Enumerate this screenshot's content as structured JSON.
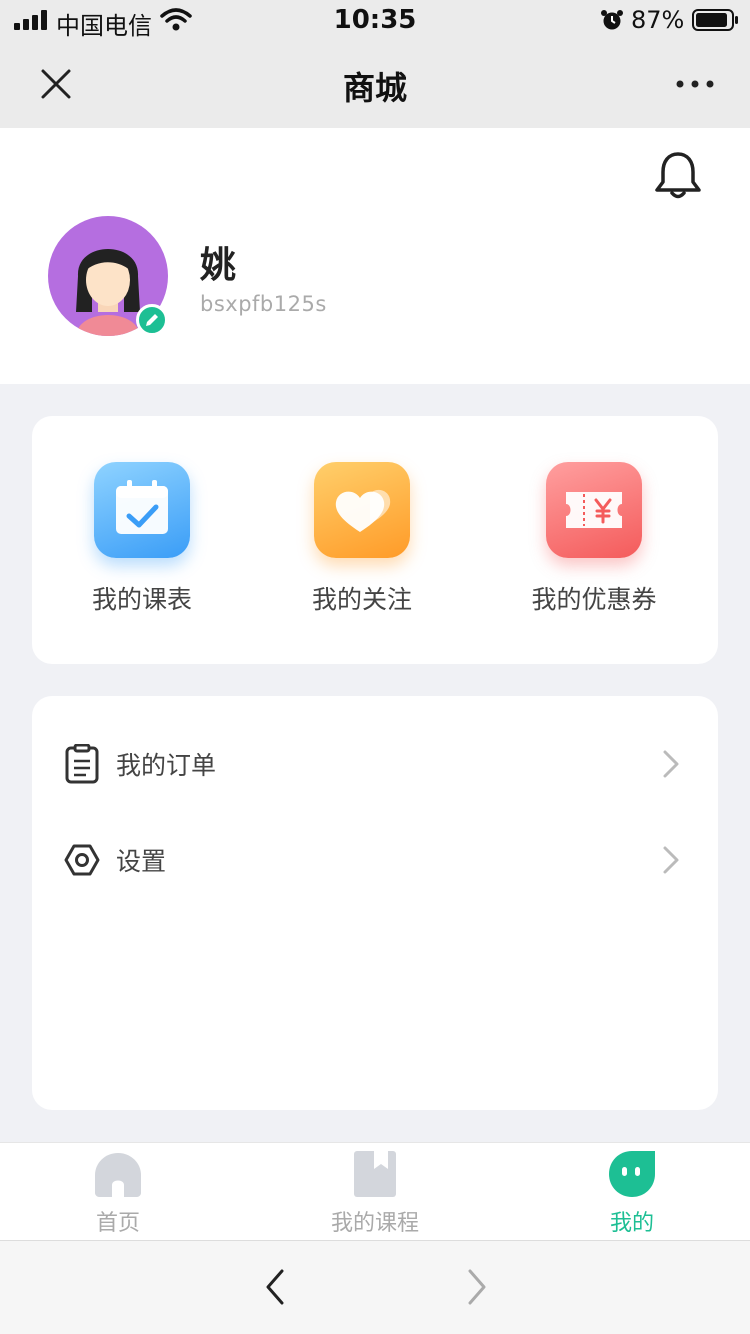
{
  "status_bar": {
    "carrier": "中国电信",
    "time": "10:35",
    "battery": "87%",
    "icons": [
      "signal-icon",
      "wifi-icon",
      "alarm-icon",
      "battery-icon"
    ]
  },
  "nav": {
    "title": "商城",
    "icons": [
      "close-icon",
      "more-icon"
    ]
  },
  "profile": {
    "name": "姚",
    "user_id": "bsxpfb125s",
    "icons": [
      "bell-icon",
      "avatar",
      "edit-icon"
    ]
  },
  "shortcuts": [
    {
      "label": "我的课表",
      "icon": "calendar-icon",
      "color": "#3a9df7"
    },
    {
      "label": "我的关注",
      "icon": "hearts-icon",
      "color": "#ff9b28"
    },
    {
      "label": "我的优惠券",
      "icon": "coupon-icon",
      "color": "#f45b5b"
    }
  ],
  "menu": [
    {
      "label": "我的订单",
      "icon": "order-icon"
    },
    {
      "label": "设置",
      "icon": "settings-icon"
    }
  ],
  "tabs": [
    {
      "label": "首页",
      "icon": "home-icon",
      "active": false
    },
    {
      "label": "我的课程",
      "icon": "book-icon",
      "active": false
    },
    {
      "label": "我的",
      "icon": "me-icon",
      "active": true
    }
  ],
  "browser": {
    "icons": [
      "back-icon",
      "forward-icon"
    ]
  },
  "colors": {
    "accent": "#1dbf94",
    "avatar_bg": "#b56ee0",
    "page_bg": "#f0f1f5"
  }
}
